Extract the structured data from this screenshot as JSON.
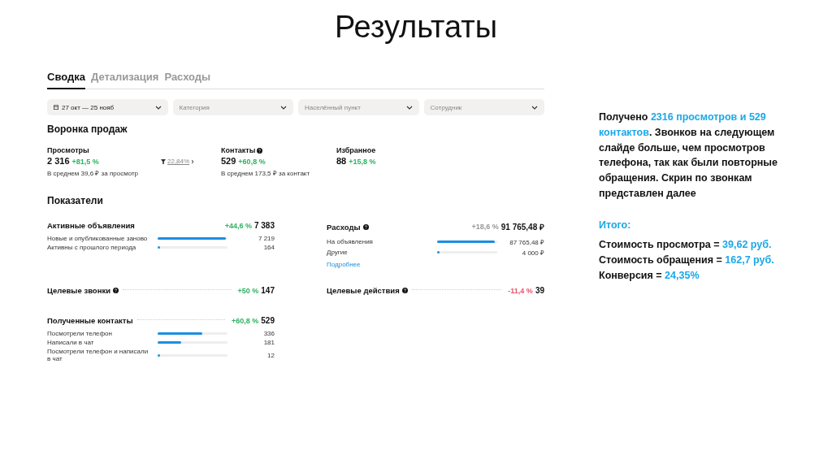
{
  "title": "Результаты",
  "dashboard": {
    "tabs": [
      {
        "label": "Сводка",
        "selected": true
      },
      {
        "label": "Детализация",
        "selected": false
      },
      {
        "label": "Расходы",
        "selected": false
      }
    ],
    "filters": [
      {
        "kind": "date",
        "value": "27 окт — 25 нояб"
      },
      {
        "kind": "select",
        "placeholder": "Категория"
      },
      {
        "kind": "select",
        "placeholder": "Населённый пункт"
      },
      {
        "kind": "select",
        "placeholder": "Сотрудник"
      }
    ],
    "funnel": {
      "title": "Воронка продаж",
      "metrics": [
        {
          "label": "Просмотры",
          "help": false,
          "value": "2 316",
          "change": "+81,5 %",
          "note": "В среднем 39,6 ₽ за просмотр",
          "conversion": "22,84%"
        },
        {
          "label": "Контакты",
          "help": true,
          "value": "529",
          "change": "+60,8 %",
          "note": "В среднем 173,5 ₽ за контакт"
        },
        {
          "label": "Избранное",
          "help": false,
          "value": "88",
          "change": "+15,8 %"
        }
      ]
    },
    "indicators": {
      "title": "Показатели",
      "cards": [
        {
          "title": "Активные объявления",
          "help": false,
          "dotted": false,
          "change": "+44,6 %",
          "color": "#2bb360",
          "total": "7 383",
          "rows": [
            {
              "label": "Новые и опубликованные заново",
              "level": 0.98,
              "value": "7 219"
            },
            {
              "label": "Активны с прошлого периода",
              "level": 0.02,
              "value": "164"
            }
          ]
        },
        {
          "title": "Расходы",
          "help": true,
          "dotted": false,
          "change": "+18,6 %",
          "color": "#999999",
          "total": "91 765,48 ₽",
          "rows": [
            {
              "label": "На объявления",
              "level": 0.96,
              "value": "87 765,48 ₽"
            },
            {
              "label": "Другие",
              "level": 0.04,
              "value": "4 000 ₽"
            }
          ],
          "link": "Подробнее"
        },
        {
          "title": "Целевые звонки",
          "help": true,
          "dotted": true,
          "change": "+50 %",
          "color": "#2bb360",
          "total": "147"
        },
        {
          "title": "Целевые действия",
          "help": true,
          "dotted": true,
          "change": "-11,4 %",
          "color": "#e5536b",
          "total": "39"
        },
        {
          "title": "Полученные контакты",
          "help": false,
          "dotted": true,
          "change": "+60,8 %",
          "color": "#2bb360",
          "total": "529",
          "rows": [
            {
              "label": "Посмотрели телефон",
              "level": 0.64,
              "value": "336"
            },
            {
              "label": "Написали в чат",
              "level": 0.34,
              "value": "181"
            },
            {
              "label": "Посмотрели телефон и написали в чат",
              "level": 0.02,
              "value": "12"
            }
          ]
        }
      ]
    }
  },
  "notes": {
    "paragraph": [
      {
        "text": "Получено ",
        "highlight": false
      },
      {
        "text": "2316 просмотров и 529 контактов",
        "highlight": true
      },
      {
        "text": ". Звонков на следующем слайде больше, чем просмотров телефона, так как были повторные обращения. Скрин по звонкам представлен далее",
        "highlight": false
      }
    ],
    "heading": "Итого:",
    "lines": [
      {
        "label": "Стоимость просмотра = ",
        "value": "39,62 руб."
      },
      {
        "label": "Стоимость обращения = ",
        "value": "162,7 руб."
      },
      {
        "label": "Конверсия = ",
        "value": "24,35%"
      }
    ]
  }
}
